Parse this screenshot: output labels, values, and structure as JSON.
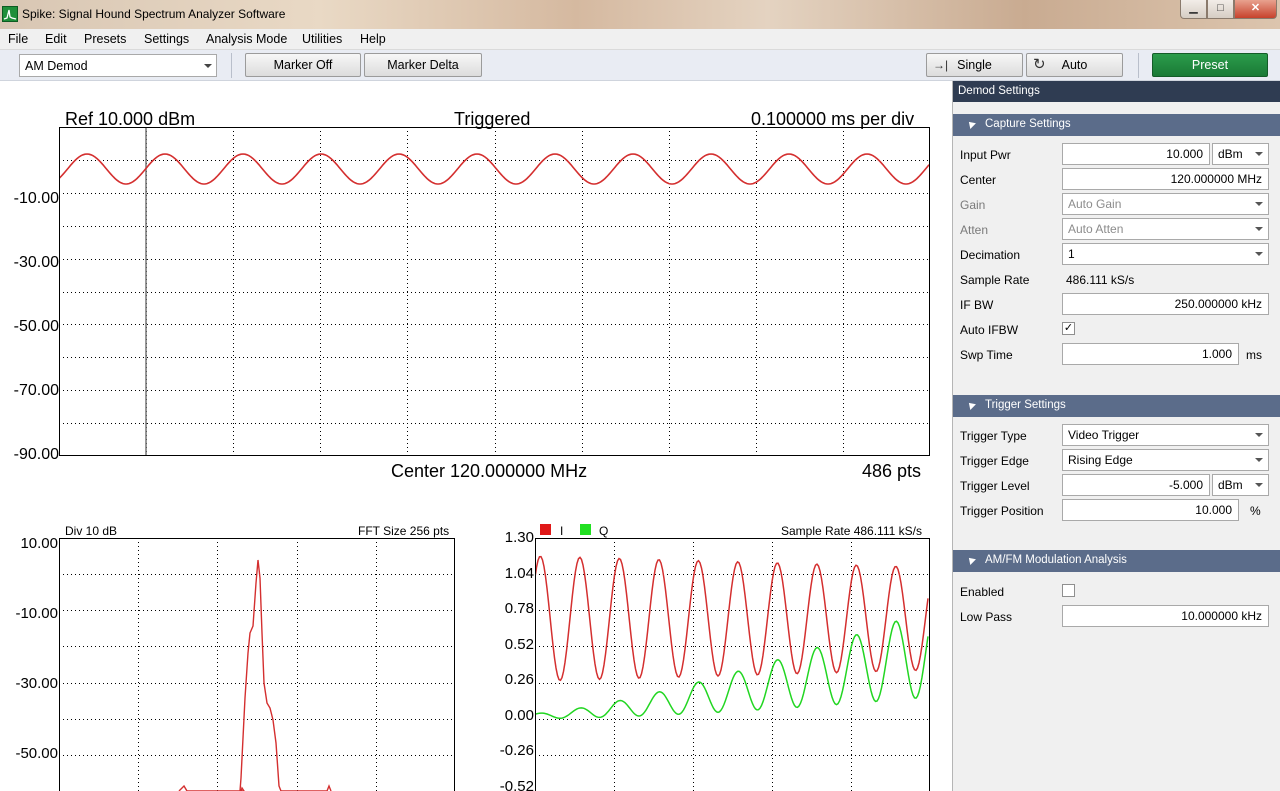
{
  "window": {
    "title": "Spike: Signal Hound Spectrum Analyzer Software",
    "minimize": "▁",
    "maximize": "□",
    "close": "✕"
  },
  "menu": [
    "File",
    "Edit",
    "Presets",
    "Settings",
    "Analysis Mode",
    "Utilities",
    "Help"
  ],
  "toolbar": {
    "mode": "AM Demod",
    "marker_off": "Marker Off",
    "marker_delta": "Marker Delta",
    "single": "Single",
    "auto": "Auto",
    "preset": "Preset",
    "single_icon": "single-sweep-icon",
    "auto_icon": "auto-sweep-icon"
  },
  "colors": {
    "trace_red": "#d42f2f",
    "trace_green": "#22d622",
    "preset_green": "#1f8a3f",
    "panel_header": "#2f3c52",
    "section_header": "#5b6c8a"
  },
  "main_plot": {
    "ref": "Ref 10.000 dBm",
    "status": "Triggered",
    "timebase": "0.100000 ms per div",
    "center": "Center 120.000000 MHz",
    "points": "486 pts",
    "y_ticks": [
      "-10.00",
      "-30.00",
      "-50.00",
      "-70.00",
      "-90.00"
    ]
  },
  "fft_plot": {
    "div": "Div 10 dB",
    "fft_size": "FFT Size 256 pts",
    "y_ticks": [
      "10.00",
      "-10.00",
      "-30.00",
      "-50.00"
    ]
  },
  "iq_plot": {
    "legend_i": "I",
    "legend_q": "Q",
    "sample_rate": "Sample Rate 486.111 kS/s",
    "y_ticks": [
      "1.30",
      "1.04",
      "0.78",
      "0.52",
      "0.26",
      "0.00",
      "-0.26",
      "-0.52"
    ]
  },
  "panel": {
    "title": "Demod Settings",
    "capture": {
      "header": "Capture Settings",
      "input_pwr_label": "Input Pwr",
      "input_pwr": "10.000",
      "input_pwr_unit": "dBm",
      "center_label": "Center",
      "center": "120.000000 MHz",
      "gain_label": "Gain",
      "gain": "Auto Gain",
      "atten_label": "Atten",
      "atten": "Auto Atten",
      "decimation_label": "Decimation",
      "decimation": "1",
      "sample_rate_label": "Sample Rate",
      "sample_rate": "486.111 kS/s",
      "ifbw_label": "IF BW",
      "ifbw": "250.000000 kHz",
      "auto_ifbw_label": "Auto IFBW",
      "auto_ifbw_checked": true,
      "auto_ifbw_mark": "✓",
      "swp_time_label": "Swp Time",
      "swp_time": "1.000",
      "swp_time_unit": "ms"
    },
    "trigger": {
      "header": "Trigger Settings",
      "type_label": "Trigger Type",
      "type": "Video Trigger",
      "edge_label": "Trigger Edge",
      "edge": "Rising Edge",
      "level_label": "Trigger Level",
      "level": "-5.000",
      "level_unit": "dBm",
      "position_label": "Trigger Position",
      "position": "10.000",
      "position_unit": "%"
    },
    "modulation": {
      "header": "AM/FM Modulation Analysis",
      "enabled_label": "Enabled",
      "enabled_checked": false,
      "lowpass_label": "Low Pass",
      "lowpass": "10.000000 kHz"
    }
  }
}
